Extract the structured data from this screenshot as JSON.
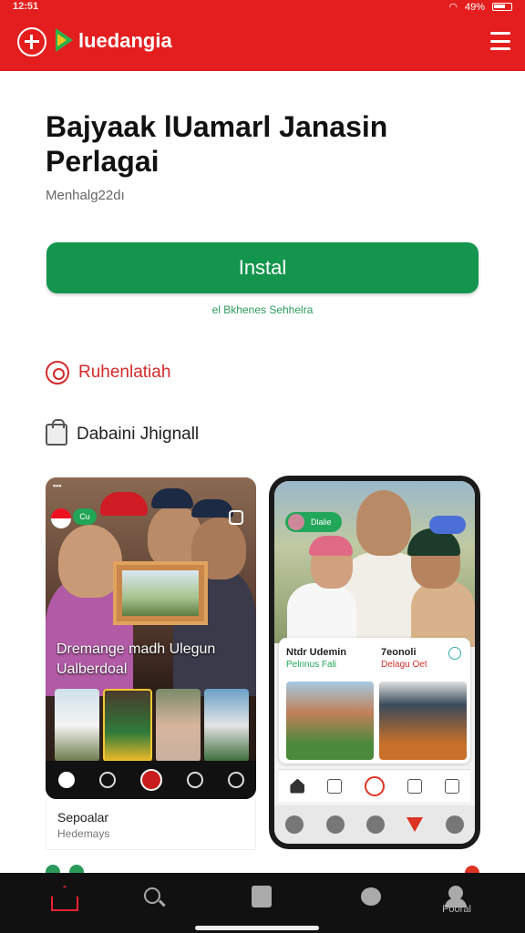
{
  "status_bar": {
    "time": "12:51",
    "battery": "49%"
  },
  "app_bar": {
    "brand": "luedangia"
  },
  "app": {
    "title": "Bajyaak lUamarl Janasin Perlagai",
    "subtitle": "Menhalg22dı",
    "install_label": "Instal",
    "install_note": "el Bkhenes Sehhelra"
  },
  "sections": {
    "rating_label": "Ruhenlatiah",
    "category_label": "Dabaini Jhignall"
  },
  "screenshot1": {
    "pill": "Cu",
    "caption": "Dremange madh Ulegun Ualberdoal",
    "label_title": "Sepoalar",
    "label_sub": "Hedemays"
  },
  "screenshot2": {
    "pill": "Dlalie",
    "card_left_title": "Ntdr Udemin",
    "card_left_sub": "Pelnnus Fali",
    "card_right_title": "7eonoli",
    "card_right_sub": "Delagu Oet"
  },
  "bottom_nav": {
    "profile_label": "Pooral"
  },
  "colors": {
    "accent_red": "#e41e1e",
    "install_green": "#14954d"
  }
}
